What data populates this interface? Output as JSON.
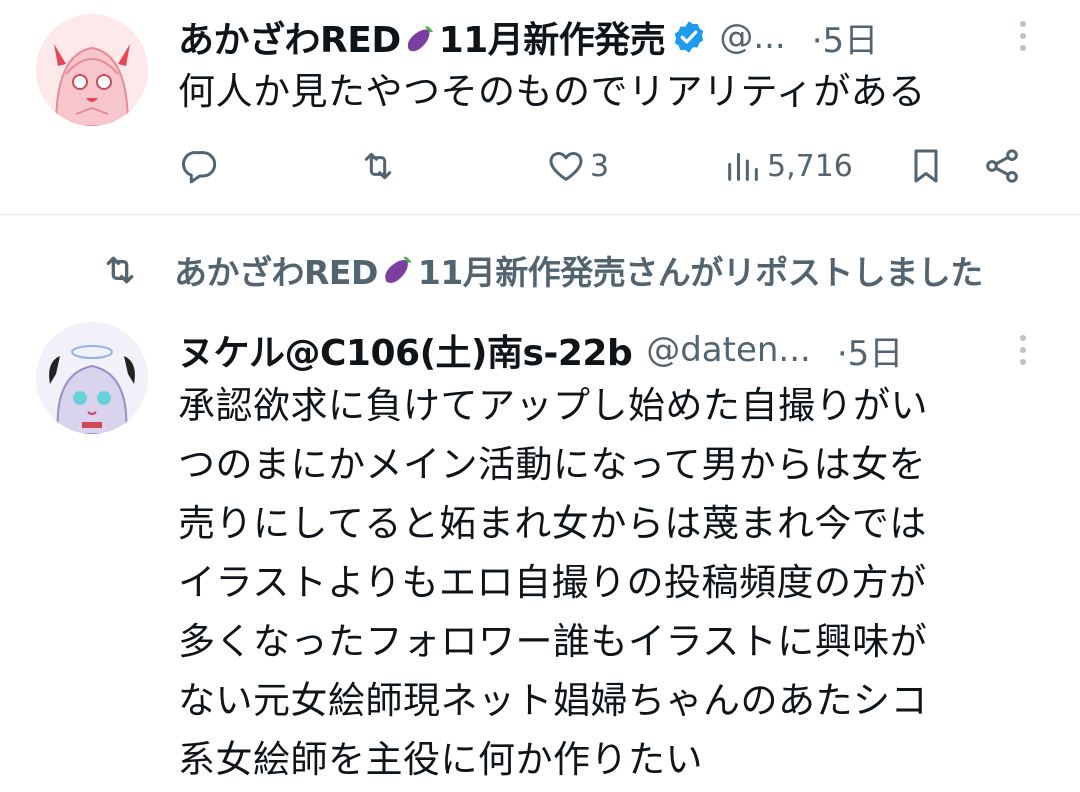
{
  "tweet1": {
    "display_name_a": "あかざわRED",
    "display_name_b": "11月新作発売",
    "emoji": "eggplant-emoji",
    "handle": "@...",
    "time": "·5日",
    "text": "何人か見たやつそのものでリアリティがある",
    "replies": "",
    "reposts": "",
    "likes": "3",
    "views": "5,716"
  },
  "repost_banner": {
    "name_a": "あかざわRED",
    "name_b": "11月新作発売さんがリポストしました"
  },
  "tweet2": {
    "display_name": "ヌケル@C106(土)南s-22b",
    "handle": "@daten...",
    "time": "·5日",
    "lines": [
      "承認欲求に負けてアップし始めた自撮りがい",
      "つのまにかメイン活動になって男からは女を",
      "売りにしてると妬まれ女からは蔑まれ今では",
      "イラストよりもエロ自撮りの投稿頻度の方が",
      "多くなったフォロワー誰もイラストに興味が",
      "ない元女絵師現ネット娼婦ちゃんのあたシコ",
      "系女絵師を主役に何か作りたい"
    ]
  },
  "colors": {
    "text": "#0f1419",
    "secondary": "#536471",
    "verified": "#1d9bf0",
    "divider": "#e4e7ea"
  }
}
